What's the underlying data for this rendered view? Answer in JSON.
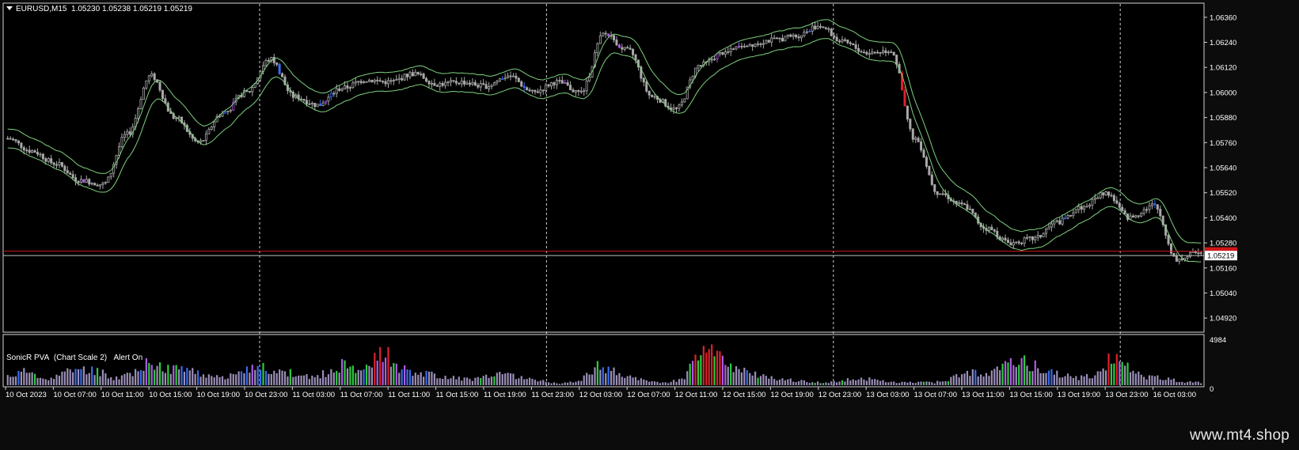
{
  "window": {
    "symbol": "EURUSD,M15",
    "ohlc": "1.05230 1.05238 1.05219 1.05219",
    "indicator_name": "SonicR PVA",
    "indicator_scale": "(Chart Scale 2)",
    "indicator_alert": "Alert On",
    "watermark": "www.mt4.shop",
    "icon": "dropdown-triangle-icon"
  },
  "colors": {
    "background": "#000000",
    "frame": "#0c0c0c",
    "candle_neutral": "#a9a9a9",
    "candle_bull_climax": "#2ecc40",
    "candle_bear_climax": "#e0202a",
    "candle_blue": "#3a6cf0",
    "candle_magenta": "#b05ae6",
    "envelope_line": "#7ed07e",
    "bid_line": "#c0c0c0",
    "ask_line": "#d01818",
    "price_tag_bg": "#ffffff",
    "price_tag_bg_red": "#d01818"
  },
  "chart_data": [
    {
      "type": "line",
      "title": "EURUSD,M15  1.05230 1.05238 1.05219 1.05219",
      "ylim": [
        1.0486,
        1.0642
      ],
      "y_ticks": [
        "1.06360",
        "1.06240",
        "1.06120",
        "1.06000",
        "1.05880",
        "1.05760",
        "1.05640",
        "1.05520",
        "1.05400",
        "1.05280",
        "1.05160",
        "1.05040",
        "1.04920"
      ],
      "current_price": "1.05219",
      "ask_price": 1.0524,
      "x_ticks": [
        "10 Oct 2023",
        "10 Oct 07:00",
        "10 Oct 11:00",
        "10 Oct 15:00",
        "10 Oct 19:00",
        "10 Oct 23:00",
        "11 Oct 03:00",
        "11 Oct 07:00",
        "11 Oct 11:00",
        "11 Oct 15:00",
        "11 Oct 19:00",
        "11 Oct 23:00",
        "12 Oct 03:00",
        "12 Oct 07:00",
        "12 Oct 11:00",
        "12 Oct 15:00",
        "12 Oct 19:00",
        "12 Oct 23:00",
        "13 Oct 03:00",
        "13 Oct 07:00",
        "13 Oct 11:00",
        "13 Oct 15:00",
        "13 Oct 19:00",
        "13 Oct 23:00",
        "16 Oct 03:00"
      ],
      "series": [
        {
          "x": [
            0,
            2,
            4,
            6,
            8,
            10,
            12,
            14,
            16,
            18,
            20,
            22,
            24,
            26,
            28,
            30,
            32,
            34,
            36,
            38,
            40,
            42,
            44,
            46,
            48,
            50,
            52,
            54,
            56,
            58,
            60,
            62,
            64,
            66,
            68,
            70,
            72,
            74,
            76,
            78,
            80,
            82,
            84,
            86,
            88,
            90,
            92,
            94,
            96,
            98,
            100
          ],
          "y": [
            1.0578,
            1.0572,
            1.0566,
            1.0558,
            1.0556,
            1.058,
            1.0608,
            1.0588,
            1.0576,
            1.059,
            1.06,
            1.0616,
            1.0598,
            1.0594,
            1.0602,
            1.0606,
            1.0605,
            1.0609,
            1.0604,
            1.0605,
            1.0603,
            1.0608,
            1.06,
            1.0605,
            1.06,
            1.0628,
            1.062,
            1.0598,
            1.0592,
            1.0613,
            1.0619,
            1.0623,
            1.0625,
            1.0627,
            1.0632,
            1.0624,
            1.0619,
            1.062,
            1.0578,
            1.0552,
            1.0546,
            1.0535,
            1.0528,
            1.053,
            1.0538,
            1.0545,
            1.0552,
            1.054,
            1.0546,
            1.052,
            1.0524
          ]
        }
      ]
    },
    {
      "type": "bar",
      "title": "SonicR PVA (Chart Scale 2) Alert On",
      "ylim": [
        0,
        4984
      ],
      "y_ticks": [
        "4984",
        "0"
      ],
      "values": [
        1100,
        1600,
        700,
        1300,
        2100,
        1700,
        800,
        1500,
        2900,
        1900,
        2100,
        1300,
        800,
        1300,
        2200,
        1700,
        1400,
        900,
        1500,
        2800,
        1700,
        4400,
        2200,
        1500,
        1200,
        900,
        700,
        1000,
        1300,
        900,
        500,
        200,
        400,
        2200,
        1700,
        900,
        400,
        300,
        800,
        4900,
        3000,
        2000,
        1300,
        800,
        600,
        400,
        300,
        600,
        800,
        500,
        300,
        400,
        300,
        800,
        1500,
        1200,
        2300,
        2800,
        2100,
        1400,
        800,
        1200,
        3500,
        2000,
        1000,
        800,
        400,
        300
      ]
    }
  ]
}
